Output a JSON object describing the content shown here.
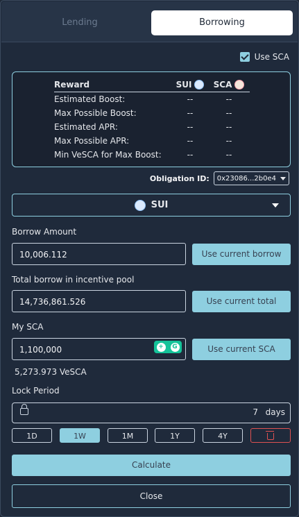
{
  "tabs": [
    {
      "label": "Lending"
    },
    {
      "label": "Borrowing"
    }
  ],
  "use_sca": {
    "label": "Use SCA",
    "checked": true
  },
  "reward_table": {
    "headers": {
      "reward": "Reward",
      "sui": "SUI",
      "sca": "SCA"
    },
    "rows": [
      {
        "name": "Estimated Boost:",
        "sui": "--",
        "sca": "--"
      },
      {
        "name": "Max Possible Boost:",
        "sui": "--",
        "sca": "--"
      },
      {
        "name": "Estimated APR:",
        "sui": "--",
        "sca": "--"
      },
      {
        "name": "Max Possible APR:",
        "sui": "--",
        "sca": "--"
      },
      {
        "name": "Min VeSCA for Max Boost:",
        "sui": "--",
        "sca": "--"
      }
    ]
  },
  "obligation": {
    "label": "Obligation ID:",
    "value": "0x23086...2b0e4"
  },
  "coin_select": {
    "value": "SUI"
  },
  "borrow_amount": {
    "label": "Borrow Amount",
    "value": "10,006.112",
    "button": "Use current borrow"
  },
  "total_borrow": {
    "label": "Total borrow in incentive pool",
    "value": "14,736,861.526",
    "button": "Use current total"
  },
  "my_sca": {
    "label": "My SCA",
    "value": "1,100,000",
    "button": "Use current SCA",
    "vesca": "5,273.973 VeSCA"
  },
  "lock_period": {
    "label": "Lock Period",
    "value": "7",
    "unit": "days"
  },
  "period_options": [
    "1D",
    "1W",
    "1M",
    "1Y",
    "4Y"
  ],
  "selected_period": "1W",
  "actions": {
    "calculate": "Calculate",
    "close": "Close"
  },
  "colors": {
    "accent": "#8ecfe0",
    "background": "#1f2a3b",
    "danger": "#e05252"
  }
}
